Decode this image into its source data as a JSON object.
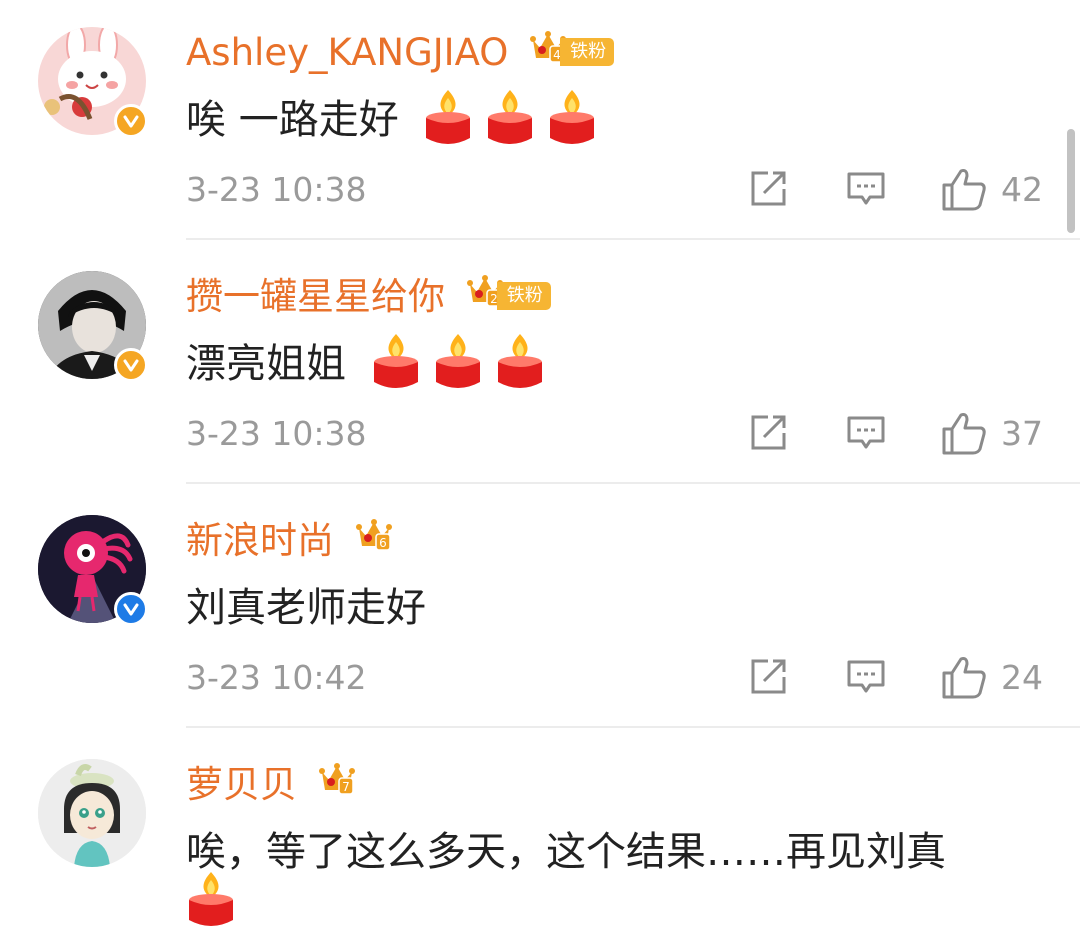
{
  "comments": [
    {
      "username": "Ashley_KANGJIAO",
      "fan_badge": "铁粉",
      "fan_level": "4",
      "text": "唉 一路走好",
      "candles": 3,
      "time": "3-23 10:38",
      "likes": "42",
      "verified": "gold"
    },
    {
      "username": "攒一罐星星给你",
      "fan_badge": "铁粉",
      "fan_level": "2",
      "text": "漂亮姐姐",
      "candles": 3,
      "time": "3-23 10:38",
      "likes": "37",
      "verified": "gold"
    },
    {
      "username": "新浪时尚",
      "fan_level": "6",
      "text": "刘真老师走好",
      "candles": 0,
      "time": "3-23 10:42",
      "likes": "24",
      "verified": "blue"
    },
    {
      "username": "萝贝贝",
      "fan_level": "7",
      "text": "唉，等了这么多天，这个结果……再见刘真",
      "candles": 1
    }
  ],
  "colors": {
    "username": "#e8712a",
    "fan_badge_bg": "#f6b533",
    "crown": "#f0a020",
    "verified_gold": "#f5a623",
    "verified_blue": "#1e7be6",
    "meta": "#9a9a9a",
    "text": "#222222"
  },
  "icons": {
    "share": "share-icon",
    "comment": "comment-icon",
    "like": "like-icon",
    "candle": "candle-emoji"
  }
}
